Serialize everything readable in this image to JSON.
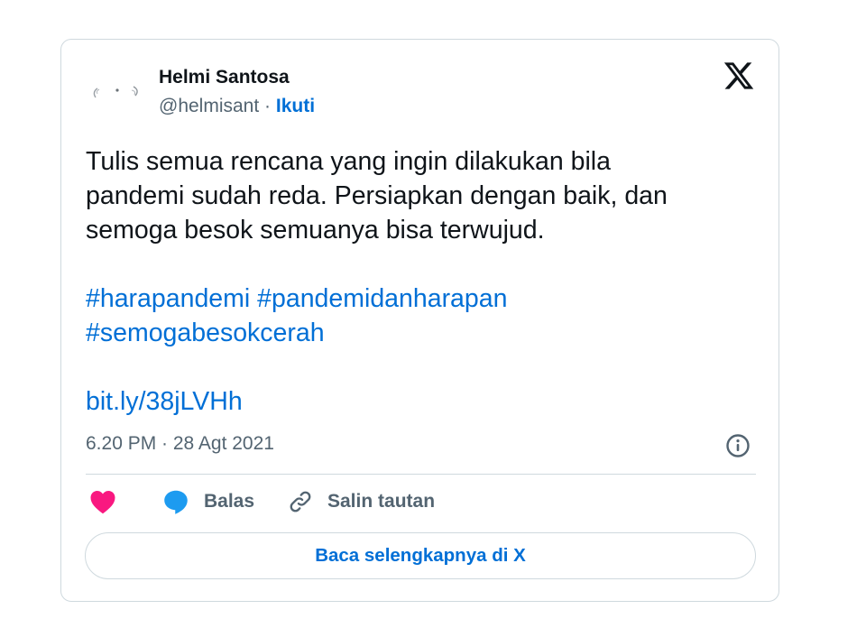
{
  "author": {
    "name": "Helmi Santosa",
    "handle": "@helmisant",
    "separator": " · ",
    "follow_label": "Ikuti"
  },
  "tweet": {
    "text_lines": [
      "Tulis semua rencana yang ingin dilakukan bila",
      "pandemi sudah reda. Persiapkan dengan baik, dan",
      "semoga besok semuanya bisa terwujud."
    ],
    "hashtags": [
      "#harapandemi",
      "#pandemidanharapan",
      "#semogabesokcerah"
    ],
    "link": "bit.ly/38jLVHh",
    "timestamp": "6.20 PM · 28 Agt 2021"
  },
  "actions": {
    "reply_label": "Balas",
    "copy_link_label": "Salin tautan"
  },
  "read_more_label": "Baca selengkapnya di X",
  "icons": {
    "brand": "x-logo-icon",
    "like": "heart-icon",
    "reply": "speech-bubble-icon",
    "copy": "link-icon",
    "info": "info-icon"
  },
  "colors": {
    "link_blue": "#006fd6",
    "like_pink": "#f91880",
    "reply_blue": "#1d9bf0",
    "muted_gray": "#536471",
    "border": "#cfd9de"
  }
}
